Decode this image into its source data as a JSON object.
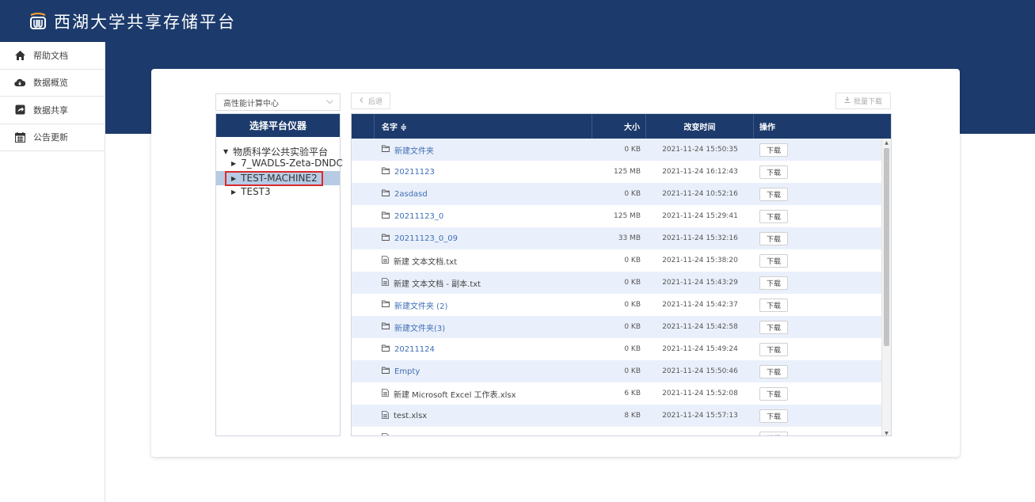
{
  "app": {
    "title": "西湖大学共享存储平台"
  },
  "sidebar": {
    "items": [
      {
        "label": "帮助文档",
        "icon": "home-icon"
      },
      {
        "label": "数据概览",
        "icon": "cloud-icon"
      },
      {
        "label": "数据共享",
        "icon": "share-icon"
      },
      {
        "label": "公告更新",
        "icon": "calendar-icon"
      }
    ]
  },
  "toolbar": {
    "dropdown_value": "高性能计算中心",
    "back_label": "后退",
    "batch_download_label": "批量下载"
  },
  "tree": {
    "header": "选择平台仪器",
    "root": "物质科学公共实验平台",
    "children": [
      "7_WADLS-Zeta-DNDC",
      "TEST-MACHINE2",
      "TEST3"
    ],
    "selected": "TEST-MACHINE2"
  },
  "table": {
    "headers": {
      "name": "名字 ≑",
      "size": "大小",
      "time": "改变时间",
      "op": "操作"
    },
    "download_label": "下载",
    "rows": [
      {
        "name": "新建文件夹",
        "size": "0 KB",
        "time": "2021-11-24 15:50:35",
        "kind": "folder"
      },
      {
        "name": "20211123",
        "size": "125 MB",
        "time": "2021-11-24 16:12:43",
        "kind": "folder"
      },
      {
        "name": "2asdasd",
        "size": "0 KB",
        "time": "2021-11-24 10:52:16",
        "kind": "folder"
      },
      {
        "name": "20211123_0",
        "size": "125 MB",
        "time": "2021-11-24 15:29:41",
        "kind": "folder"
      },
      {
        "name": "20211123_0_09",
        "size": "33 MB",
        "time": "2021-11-24 15:32:16",
        "kind": "folder"
      },
      {
        "name": "新建 文本文档.txt",
        "size": "0 KB",
        "time": "2021-11-24 15:38:20",
        "kind": "file"
      },
      {
        "name": "新建 文本文档 - 副本.txt",
        "size": "0 KB",
        "time": "2021-11-24 15:43:29",
        "kind": "file"
      },
      {
        "name": "新建文件夹 (2)",
        "size": "0 KB",
        "time": "2021-11-24 15:42:37",
        "kind": "folder"
      },
      {
        "name": "新建文件夹(3)",
        "size": "0 KB",
        "time": "2021-11-24 15:42:58",
        "kind": "folder"
      },
      {
        "name": "20211124",
        "size": "0 KB",
        "time": "2021-11-24 15:49:24",
        "kind": "folder"
      },
      {
        "name": "Empty",
        "size": "0 KB",
        "time": "2021-11-24 15:50:46",
        "kind": "folder"
      },
      {
        "name": "新建 Microsoft Excel 工作表.xlsx",
        "size": "6 KB",
        "time": "2021-11-24 15:52:08",
        "kind": "file"
      },
      {
        "name": "test.xlsx",
        "size": "8 KB",
        "time": "2021-11-24 15:57:13",
        "kind": "file"
      },
      {
        "name": "...",
        "size": "",
        "time": "",
        "kind": "file"
      }
    ]
  },
  "colors": {
    "navy": "#1c3b6c",
    "row_alt": "#eaf0fb",
    "link": "#3f6eb5",
    "highlight": "#d92b2b"
  }
}
